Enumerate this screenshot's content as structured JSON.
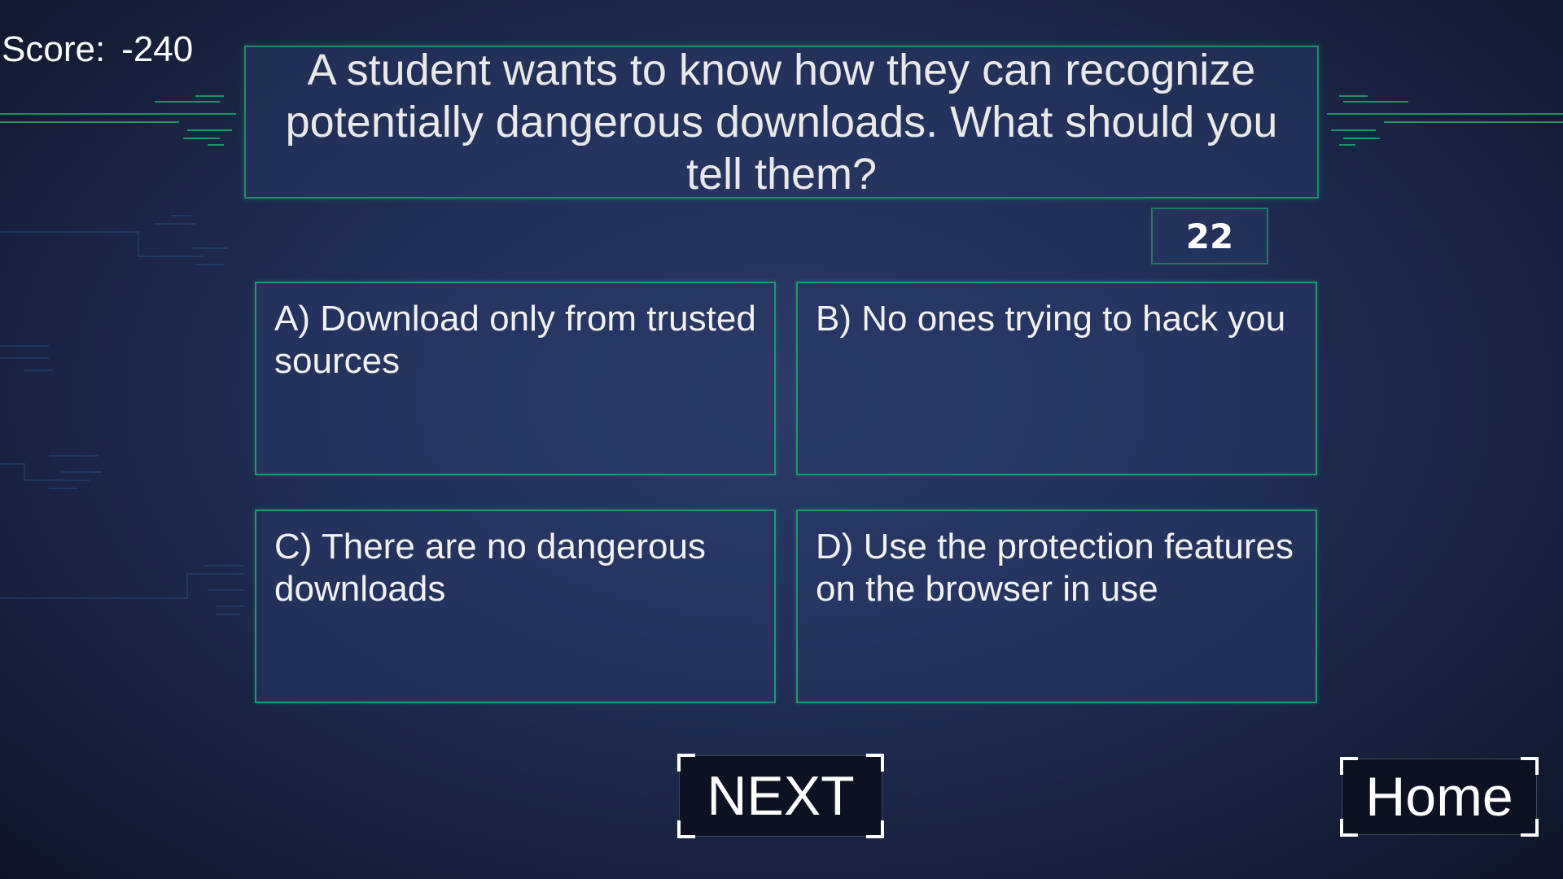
{
  "score": {
    "label": "Score:",
    "value": "-240"
  },
  "question": {
    "text": "A student wants to know how they can recognize potentially dangerous downloads. What should you tell them?"
  },
  "timer": {
    "value": "22"
  },
  "answers": [
    {
      "letter": "A",
      "text": "A) Download only from trusted sources"
    },
    {
      "letter": "B",
      "text": "B) No ones trying to hack you"
    },
    {
      "letter": "C",
      "text": "C) There are no dangerous downloads"
    },
    {
      "letter": "D",
      "text": "D) Use the protection features on the browser in use"
    }
  ],
  "buttons": {
    "next": "NEXT",
    "home": "Home"
  },
  "colors": {
    "background": "#23315a",
    "panel_border": "#1f9a6c",
    "next_corner": "#27c04a",
    "home_corner": "#4fb0e8",
    "text": "#f2f2f2"
  }
}
